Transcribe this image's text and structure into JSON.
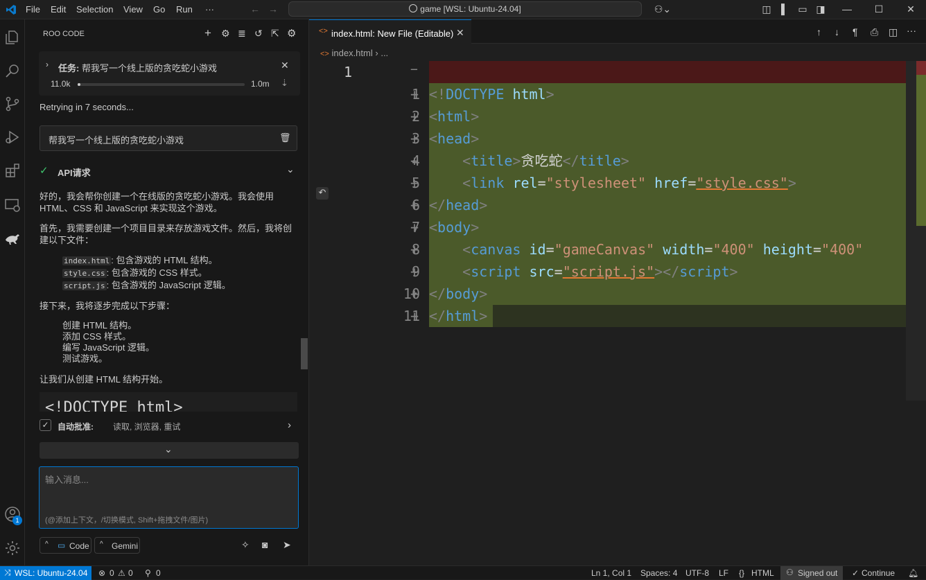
{
  "titlebar": {
    "menus": [
      "File",
      "Edit",
      "Selection",
      "View",
      "Go",
      "Run",
      "···"
    ],
    "search_text": "game [WSL: Ubuntu-24.04]"
  },
  "sidebar": {
    "title": "ROO CODE",
    "task": {
      "prefix": "任务:",
      "text": "帮我写一个线上版的贪吃蛇小游戏",
      "context_used": "11.0k",
      "context_max": "1.0m",
      "progress": 0.011
    },
    "retry_text": "Retrying in 7 seconds...",
    "user_message": "帮我写一个线上版的贪吃蛇小游戏",
    "api_request_label": "API请求",
    "response": {
      "p1": "好的，我会帮你创建一个在线版的贪吃蛇小游戏。我会使用 HTML、CSS 和 JavaScript 来实现这个游戏。",
      "p2": "首先，我需要创建一个项目目录来存放游戏文件。然后，我将创建以下文件：",
      "files": [
        {
          "name": "index.html",
          "desc": ": 包含游戏的 HTML 结构。"
        },
        {
          "name": "style.css",
          "desc": ": 包含游戏的 CSS 样式。"
        },
        {
          "name": "script.js",
          "desc": ": 包含游戏的 JavaScript 逻辑。"
        }
      ],
      "p3": "接下来，我将逐步完成以下步骤：",
      "steps": [
        "创建 HTML 结构。",
        "添加 CSS 样式。",
        "编写 JavaScript 逻辑。",
        "测试游戏。"
      ],
      "p4": "让我们从创建 HTML 结构开始。",
      "code_preview": "<!DOCTYPE html>"
    },
    "auto_approve": {
      "label": "自动批准:",
      "items": "读取, 浏览器, 重试"
    },
    "input": {
      "placeholder": "输入消息...",
      "hint": "(@添加上下文，/切换模式, Shift+拖拽文件/图片)"
    },
    "mode_button": "Code",
    "model_button": "Gemini",
    "account_badge": "1"
  },
  "editor": {
    "tab_label": "index.html: New File (Editable)",
    "breadcrumb": [
      "index.html",
      "..."
    ],
    "removed_line_number": "1",
    "lines": [
      {
        "n": "1",
        "tokens": [
          [
            "t",
            "<!"
          ],
          [
            "tn",
            "DOCTYPE"
          ],
          [
            "tx",
            " "
          ],
          [
            "at",
            "html"
          ],
          [
            "t",
            ">"
          ]
        ]
      },
      {
        "n": "2",
        "tokens": [
          [
            "t",
            "<"
          ],
          [
            "tn",
            "html"
          ],
          [
            "t",
            ">"
          ]
        ]
      },
      {
        "n": "3",
        "tokens": [
          [
            "t",
            "<"
          ],
          [
            "tn",
            "head"
          ],
          [
            "t",
            ">"
          ]
        ]
      },
      {
        "n": "4",
        "tokens": [
          [
            "tx",
            "    "
          ],
          [
            "t",
            "<"
          ],
          [
            "tn",
            "title"
          ],
          [
            "t",
            ">"
          ],
          [
            "tx",
            "贪吃蛇"
          ],
          [
            "t",
            "</"
          ],
          [
            "tn",
            "title"
          ],
          [
            "t",
            ">"
          ]
        ]
      },
      {
        "n": "5",
        "tokens": [
          [
            "tx",
            "    "
          ],
          [
            "t",
            "<"
          ],
          [
            "tn",
            "link"
          ],
          [
            "tx",
            " "
          ],
          [
            "at",
            "rel"
          ],
          [
            "tx",
            "="
          ],
          [
            "sv",
            "\"stylesheet\""
          ],
          [
            "tx",
            " "
          ],
          [
            "at",
            "href"
          ],
          [
            "tx",
            "="
          ],
          [
            "sv",
            "\"style.css\""
          ],
          [
            "t",
            ">"
          ]
        ]
      },
      {
        "n": "6",
        "tokens": [
          [
            "t",
            "</"
          ],
          [
            "tn",
            "head"
          ],
          [
            "t",
            ">"
          ]
        ]
      },
      {
        "n": "7",
        "tokens": [
          [
            "t",
            "<"
          ],
          [
            "tn",
            "body"
          ],
          [
            "t",
            ">"
          ]
        ]
      },
      {
        "n": "8",
        "tokens": [
          [
            "tx",
            "    "
          ],
          [
            "t",
            "<"
          ],
          [
            "tn",
            "canvas"
          ],
          [
            "tx",
            " "
          ],
          [
            "at",
            "id"
          ],
          [
            "tx",
            "="
          ],
          [
            "sv",
            "\"gameCanvas\""
          ],
          [
            "tx",
            " "
          ],
          [
            "at",
            "width"
          ],
          [
            "tx",
            "="
          ],
          [
            "sv",
            "\"400\""
          ],
          [
            "tx",
            " "
          ],
          [
            "at",
            "height"
          ],
          [
            "tx",
            "="
          ],
          [
            "sv",
            "\"400\""
          ]
        ]
      },
      {
        "n": "9",
        "tokens": [
          [
            "tx",
            "    "
          ],
          [
            "t",
            "<"
          ],
          [
            "tn",
            "script"
          ],
          [
            "tx",
            " "
          ],
          [
            "at",
            "src"
          ],
          [
            "tx",
            "="
          ],
          [
            "sv",
            "\"script.js\""
          ],
          [
            "t",
            "></"
          ],
          [
            "tn",
            "script"
          ],
          [
            "t",
            ">"
          ]
        ]
      },
      {
        "n": "10",
        "tokens": [
          [
            "t",
            "</"
          ],
          [
            "tn",
            "body"
          ],
          [
            "t",
            ">"
          ]
        ]
      },
      {
        "n": "11",
        "tokens": [
          [
            "t",
            "</"
          ],
          [
            "tn",
            "html"
          ],
          [
            "t",
            ">"
          ]
        ]
      }
    ]
  },
  "statusbar": {
    "remote": "WSL: Ubuntu-24.04",
    "errors": "0",
    "warnings": "0",
    "ports": "0",
    "position": "Ln 1, Col 1",
    "spaces": "Spaces: 4",
    "encoding": "UTF-8",
    "eol": "LF",
    "language": "HTML",
    "signed_out": "Signed out",
    "continue": "Continue"
  },
  "colors": {
    "accent": "#0078d4",
    "added_bg": "#4b5a2a",
    "removed_bg": "#4b1818",
    "bg": "#1f1f1f",
    "sidebar_bg": "#181818"
  }
}
